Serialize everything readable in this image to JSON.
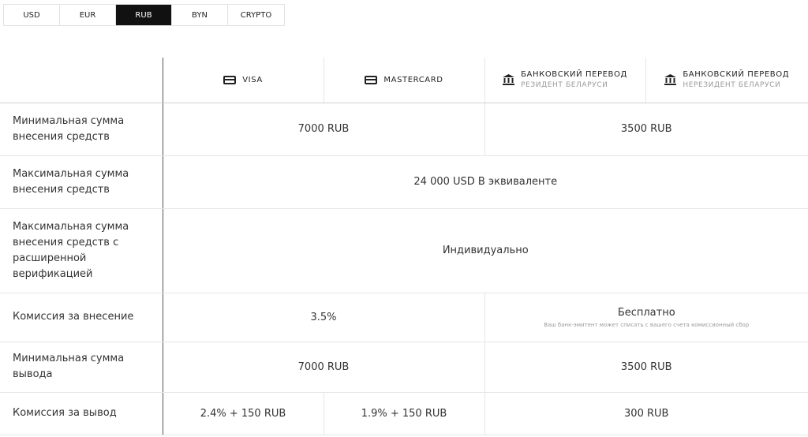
{
  "currency_tabs": [
    {
      "label": "USD",
      "active": false
    },
    {
      "label": "EUR",
      "active": false
    },
    {
      "label": "RUB",
      "active": true
    },
    {
      "label": "BYN",
      "active": false
    },
    {
      "label": "CRYPTO",
      "active": false
    }
  ],
  "columns": {
    "visa": {
      "title": "VISA",
      "icon": "credit-card-icon"
    },
    "mastercard": {
      "title": "MASTERCARD",
      "icon": "credit-card-icon"
    },
    "bank_resident": {
      "title": "БАНКОВСКИЙ ПЕРЕВОД",
      "subtitle": "РЕЗИДЕНТ БЕЛАРУСИ",
      "icon": "bank-icon"
    },
    "bank_nonresident": {
      "title": "БАНКОВСКИЙ ПЕРЕВОД",
      "subtitle": "НЕРЕЗИДЕНТ БЕЛАРУСИ",
      "icon": "bank-icon"
    }
  },
  "rows": {
    "min_deposit": {
      "label": "Минимальная сумма внесения средств",
      "cards": "7000 RUB",
      "bank": "3500 RUB"
    },
    "max_deposit": {
      "label": "Максимальная сумма внесения средств",
      "all": "24 000 USD В эквиваленте"
    },
    "max_deposit_ext": {
      "label": "Максимальная сумма внесения средств с расширенной верификацией",
      "all": "Индивидуально"
    },
    "deposit_fee": {
      "label": "Комиссия за внесение",
      "cards": "3.5%",
      "bank": "Бесплатно",
      "bank_note": "Ваш банк-эмитент может списать с вашего счета комиссионный сбор"
    },
    "min_withdraw": {
      "label": "Минимальная сумма вывода",
      "cards": "7000 RUB",
      "bank": "3500 RUB"
    },
    "withdraw_fee": {
      "label": "Комиссия за вывод",
      "visa": "2.4% + 150 RUB",
      "mastercard": "1.9% + 150 RUB",
      "bank": "300 RUB"
    }
  }
}
